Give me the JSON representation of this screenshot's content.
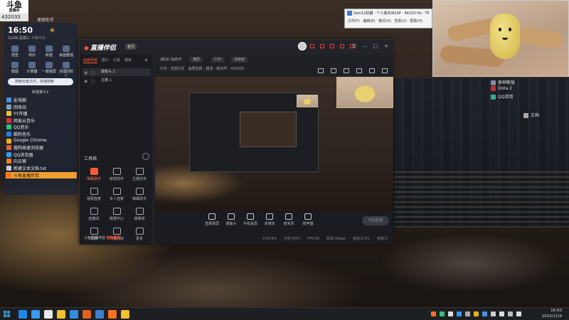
{
  "desktop": {
    "logo": "斗鱼",
    "logo_sub": "直播间",
    "room_id": "432033",
    "panel_title": "桌面助手",
    "clock": "16:50",
    "date": "11/09 星期三 十月十六",
    "weather_icon": "☀",
    "widget_tiles": [
      "便签",
      "待办",
      "新建",
      "桌面整理",
      "截图",
      "计算器",
      "一键锁屏",
      "清理回收站"
    ],
    "search_placeholder": "搜索全盘文件，快捷搜索",
    "group_title": "新建格子2",
    "shortcuts": [
      {
        "label": "此电脑",
        "color": "#4a8fe0"
      },
      {
        "label": "回收站",
        "color": "#7aa0c0"
      },
      {
        "label": "YY开播",
        "color": "#f0c030"
      },
      {
        "label": "网易云音乐",
        "color": "#d33"
      },
      {
        "label": "QQ音乐",
        "color": "#31c27c"
      },
      {
        "label": "酷狗音乐",
        "color": "#2a7fe0"
      },
      {
        "label": "Google Chrome",
        "color": "#e8b020"
      },
      {
        "label": "搜狗高速浏览器",
        "color": "#e06030"
      },
      {
        "label": "QQ浏览器",
        "color": "#3a9af0"
      },
      {
        "label": "向日葵",
        "color": "#f08020"
      },
      {
        "label": "新建文本文档.txt",
        "color": "#ccc"
      },
      {
        "label": "斗鱼直播伴侣",
        "color": "#ff7020",
        "active": true
      }
    ],
    "right_icons": [
      {
        "label": "原神新版",
        "color": "#88a"
      },
      {
        "label": "Dota 2",
        "color": "#b33"
      },
      {
        "label": "QQ游戏",
        "color": "#3a8"
      },
      {
        "label": "文档",
        "color": "#aaa"
      }
    ]
  },
  "app": {
    "logo": "直播伴侣",
    "version": "官方",
    "scene_tabs": [
      "画面场景",
      "图片",
      "打版",
      "模板"
    ],
    "sources": [
      "摄像头 2",
      "主播 1"
    ],
    "preview_title": "(武汉) 钻石卡",
    "preview_pills": [
      "横屏",
      "户外",
      "清晰度"
    ],
    "preview_meta": "户外 · 全部分区",
    "preview_meta2": "画质选择 · 超清 · 房间号：432033",
    "toolbox_title": "工具箱",
    "tools": [
      {
        "label": "弹幕助手",
        "hot": true
      },
      {
        "label": "房管助手",
        "hot": false
      },
      {
        "label": "主播任务",
        "hot": false
      },
      {
        "label": "视频连麦",
        "hot": false
      },
      {
        "label": "多人连麦",
        "hot": false
      },
      {
        "label": "弹幕助手",
        "hot": false
      },
      {
        "label": "直播间",
        "hot": false
      },
      {
        "label": "数据中心",
        "hot": false
      },
      {
        "label": "弹幕墙",
        "hot": false
      },
      {
        "label": "礼物",
        "hot": false
      },
      {
        "label": "开播计划",
        "hot": false
      },
      {
        "label": "更多",
        "hot": false
      }
    ],
    "footer_prefix": "斗鱼直播伴侣",
    "footer_link": "使用教程",
    "bottom_items": [
      "直播录屏",
      "摄像头",
      "手机投屏",
      "多媒体",
      "麦克风",
      "扬声器"
    ],
    "go_live": "开始直播",
    "status": [
      "CPU:9%",
      "内存:50%",
      "FPS:60",
      "码率:0kbps",
      "丢帧:0.0%",
      "帧率:0"
    ]
  },
  "editor": {
    "title": "Sam12机器 - 个人版本W10P · 4K100 Hz · TE",
    "menu": [
      "文件(F)",
      "编辑(E)",
      "格式(O)",
      "查看(V)",
      "帮助(H)"
    ]
  },
  "taskbar": {
    "time": "16:50",
    "date": "2022/11/9",
    "apps": [
      "#1e88e5",
      "#3a9af0",
      "#e8e8e8",
      "#f0c030",
      "#2f8fe0",
      "#e06020",
      "#3c7fd4",
      "#ff7020",
      "#f0c030"
    ],
    "tray_colors": [
      "#ff7020",
      "#31c27c",
      "#ddd",
      "#3a9af0",
      "#aaa",
      "#e8b020",
      "#4a8fe0",
      "#ccc",
      "#ddd",
      "#bbb",
      "#ddd"
    ]
  }
}
